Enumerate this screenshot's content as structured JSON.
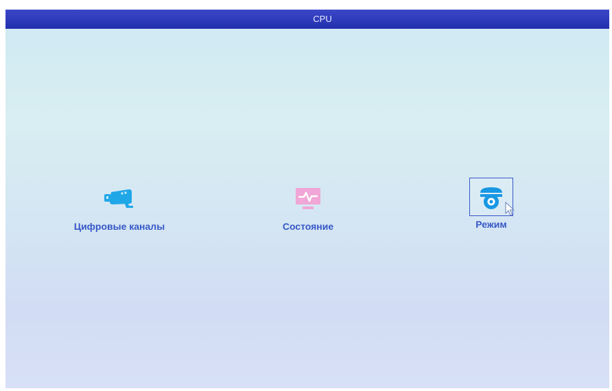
{
  "window": {
    "title": "CPU"
  },
  "menu": {
    "items": [
      {
        "label": "Цифровые каналы",
        "icon": "camera-icon",
        "color": "#1fa7e8",
        "selected": false
      },
      {
        "label": "Состояние",
        "icon": "monitor-pulse-icon",
        "color": "#f0a6d6",
        "selected": false
      },
      {
        "label": "Режим",
        "icon": "dome-camera-icon",
        "color": "#1898e4",
        "selected": true
      }
    ]
  },
  "colors": {
    "title_bar": "#2634b3",
    "label_text": "#3658c7",
    "selection_border": "#3456c8"
  }
}
